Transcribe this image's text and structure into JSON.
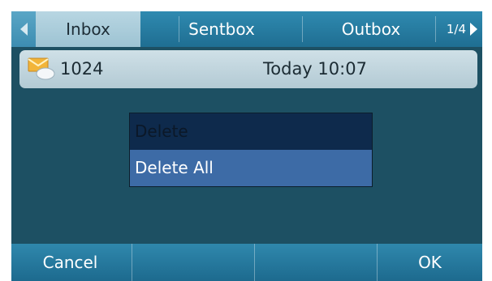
{
  "tabs": [
    {
      "label": "Inbox",
      "active": true
    },
    {
      "label": "Sentbox",
      "active": false
    },
    {
      "label": "Outbox",
      "active": false
    }
  ],
  "pager": {
    "text": "1/4"
  },
  "message": {
    "number": "1024",
    "time": "Today 10:07",
    "icon": "envelope-icon"
  },
  "menu": {
    "items": [
      {
        "label": "Delete"
      },
      {
        "label": "Delete All"
      }
    ],
    "selected_index": 1
  },
  "softkeys": {
    "left": "Cancel",
    "right": "OK"
  },
  "colors": {
    "background": "#1d5063",
    "tabbar": "#1f6e92",
    "active_tab": "#b8d6e2",
    "menu_selected": "#3d6ba6",
    "menu_item": "#0e2a4c"
  }
}
